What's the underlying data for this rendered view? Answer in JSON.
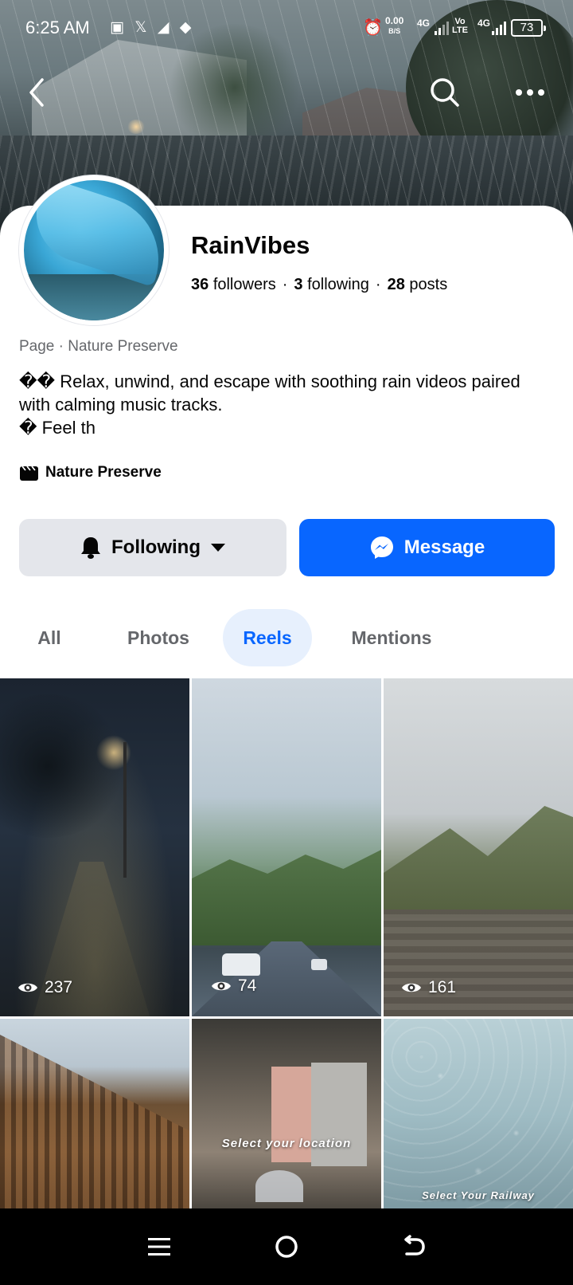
{
  "status_bar": {
    "time": "6:25 AM",
    "app_icons": "▣ 𝕏 ◢ ◆",
    "net_speed_value": "0.00",
    "net_speed_unit": "B/S",
    "signal1_label": "4G",
    "volte_top": "Vo",
    "volte_bottom": "LTE",
    "signal2_label": "4G",
    "battery_level": "73"
  },
  "profile": {
    "name": "RainVibes",
    "followers_count": "36",
    "followers_label": "followers",
    "following_count": "3",
    "following_label": "following",
    "posts_count": "28",
    "posts_label": "posts",
    "category": "Page · Nature Preserve",
    "bio": "�� Relax, unwind, and escape with soothing rain videos paired with calming music tracks.\n� Feel th",
    "tag": "Nature Preserve"
  },
  "actions": {
    "following_label": "Following",
    "message_label": "Message"
  },
  "tabs": [
    {
      "label": "All",
      "active": false
    },
    {
      "label": "Photos",
      "active": false
    },
    {
      "label": "Reels",
      "active": true
    },
    {
      "label": "Mentions",
      "active": false
    }
  ],
  "reels": [
    {
      "views": "237",
      "caption": ""
    },
    {
      "views": "74",
      "caption": ""
    },
    {
      "views": "161",
      "caption": ""
    },
    {
      "views": "",
      "caption": ""
    },
    {
      "views": "",
      "caption": "Select your location"
    },
    {
      "views": "",
      "caption": "Select Your Railway"
    }
  ],
  "colors": {
    "accent": "#0866ff",
    "secondary_button": "#e4e6eb",
    "active_tab_bg": "#e7f0fd",
    "muted_text": "#65676b"
  },
  "icons": {
    "back": "chevron-left-icon",
    "search": "search-icon",
    "more": "more-horizontal-icon",
    "bell": "bell-icon",
    "dropdown": "caret-down-icon",
    "messenger": "messenger-icon",
    "eye": "eye-icon",
    "tag": "clapperboard-icon",
    "nav_menu": "menu-icon",
    "nav_home": "home-circle-icon",
    "nav_back": "back-arrow-icon"
  }
}
